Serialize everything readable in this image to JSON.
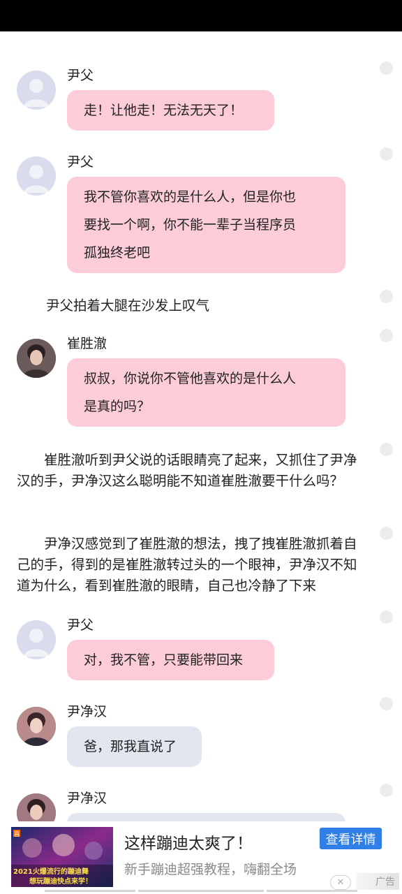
{
  "messages": [
    {
      "speaker": "尹父",
      "lines": [
        "走！让他走！无法无天了！"
      ]
    },
    {
      "speaker": "尹父",
      "lines": [
        "我不管你喜欢的是什么人，但是你也",
        "要找一个啊，你不能一辈子当程序员",
        "孤独终老吧"
      ]
    },
    {
      "speaker": "崔胜澈",
      "lines": [
        "叔叔，你说你不管他喜欢的是什么人",
        "是真的吗？"
      ]
    },
    {
      "speaker": "尹父",
      "lines": [
        "对，我不管，只要能带回来"
      ]
    },
    {
      "speaker": "尹净汉",
      "lines": [
        "爸，那我直说了"
      ]
    },
    {
      "speaker": "尹净汉"
    }
  ],
  "narrations": [
    "尹父拍着大腿在沙发上叹气",
    "崔胜澈听到尹父说的话眼睛亮了起来，又抓住了尹净汉的手，尹净汉这么聪明能不知道崔胜澈要干什么吗？",
    "尹净汉感觉到了崔胜澈的想法，拽了拽崔胜澈抓着自己的手，得到的是崔胜澈转过头的一个眼神，尹净汉不知道为什么，看到崔胜澈的眼睛，自己也冷静了下来"
  ],
  "ad": {
    "title": "这样蹦迪太爽了！",
    "subtitle": "新手蹦迪超强教程，嗨翻全场",
    "button": "查看详情",
    "tag": "广告",
    "close": "✕",
    "image_caption_1": "2021火爆流行的蹦迪舞",
    "image_caption_2": "想玩蹦迪快点来学！",
    "image_badge": "昌"
  },
  "colors": {
    "pink_bubble": "#fccdd9",
    "gray_bubble": "#e1e6ef",
    "ad_button": "#2f7fe6"
  }
}
